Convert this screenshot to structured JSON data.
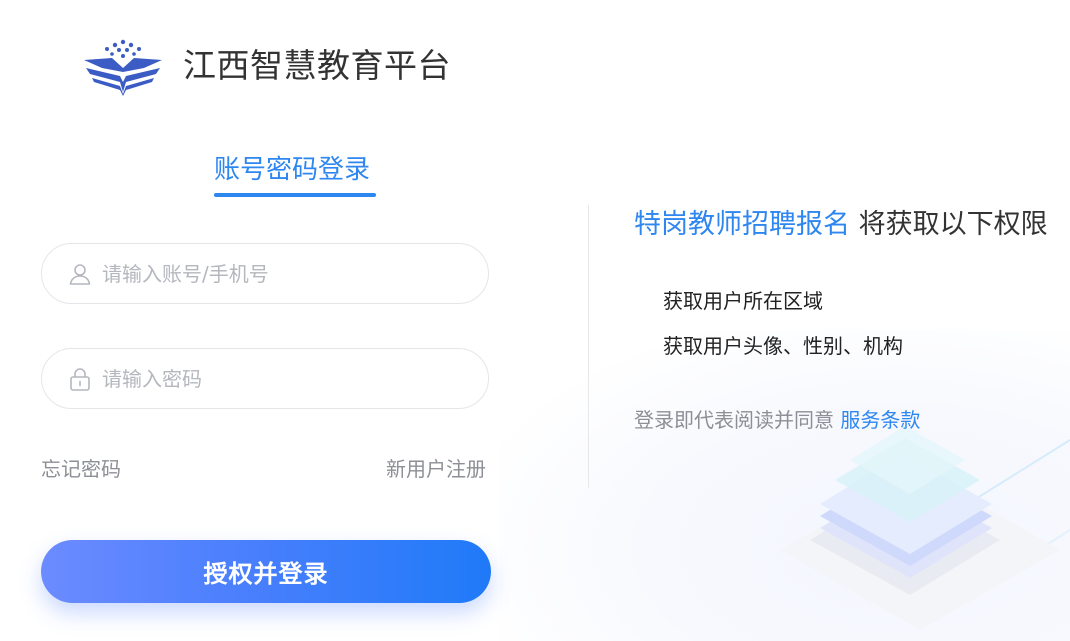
{
  "header": {
    "brand_name": "江西智慧教育平台"
  },
  "login": {
    "tab_label": "账号密码登录",
    "account_placeholder": "请输入账号/手机号",
    "account_value": "",
    "password_placeholder": "请输入密码",
    "password_value": "",
    "forgot_password": "忘记密码",
    "register": "新用户注册",
    "submit_label": "授权并登录"
  },
  "permissions": {
    "app_name": "特岗教师招聘报名",
    "title_suffix": " 将获取以下权限",
    "items": [
      "获取用户所在区域",
      "获取用户头像、性别、机构"
    ],
    "agreement_prefix": "登录即代表阅读并同意 ",
    "agreement_link": "服务条款"
  },
  "icons": {
    "logo": "book-logo-icon",
    "account": "user-icon",
    "password": "lock-icon"
  },
  "colors": {
    "accent": "#2e86f0",
    "button_start": "#6c8bff",
    "button_end": "#1f7af8",
    "muted_text": "#8c8f95",
    "placeholder": "#b4b7bd"
  }
}
